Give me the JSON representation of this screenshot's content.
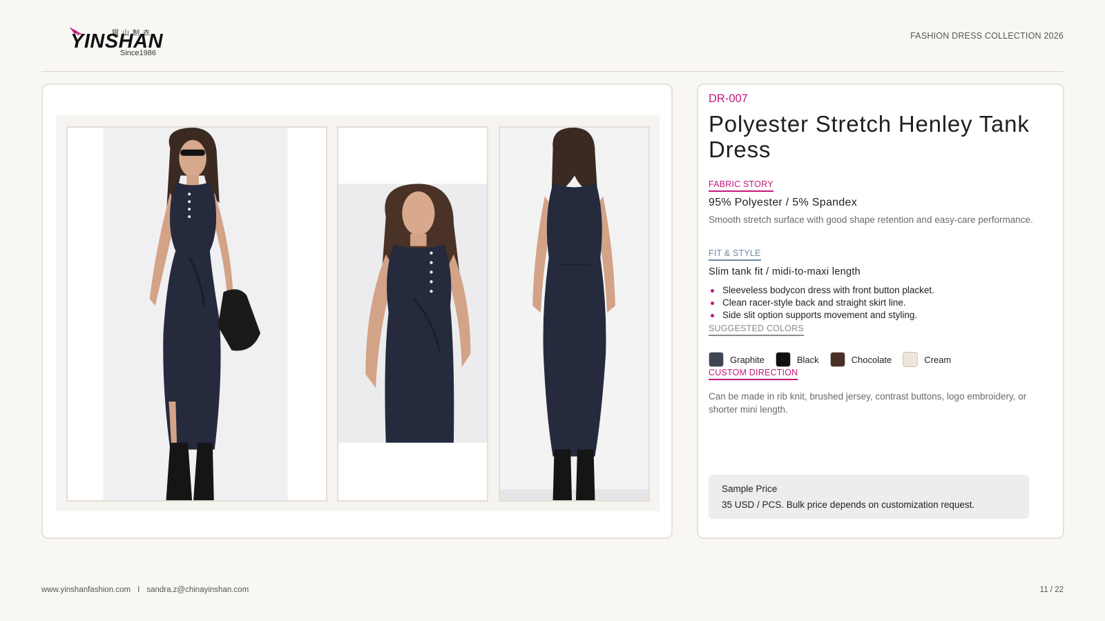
{
  "brand": {
    "name": "YINSHAN",
    "chinese_name": "银山制衣",
    "since": "Since1986",
    "accent_color": "#c2187a"
  },
  "header": {
    "collection_title": "FASHION DRESS COLLECTION 2026"
  },
  "gallery": {
    "photos": [
      {
        "view": "front-full-length",
        "dress_color": "#252a3d"
      },
      {
        "view": "front-close-up",
        "dress_color": "#252a3d"
      },
      {
        "view": "back-full-length",
        "dress_color": "#252a3d"
      }
    ]
  },
  "product": {
    "code": "DR-007",
    "title": "Polyester Stretch Henley Tank Dress",
    "fabric": {
      "label": "FABRIC STORY",
      "headline": "95% Polyester / 5% Spandex",
      "description": "Smooth stretch surface with good shape retention and easy-care performance."
    },
    "fit": {
      "label": "FIT & STYLE",
      "headline": "Slim tank fit / midi-to-maxi length",
      "bullets": [
        "Sleeveless bodycon dress with front button placket.",
        "Clean racer-style back and straight skirt line.",
        "Side slit option supports movement and styling."
      ]
    },
    "colors": {
      "label": "SUGGESTED COLORS",
      "items": [
        {
          "name": "Graphite",
          "hex": "#3e4653"
        },
        {
          "name": "Black",
          "hex": "#111111"
        },
        {
          "name": "Chocolate",
          "hex": "#4a3128"
        },
        {
          "name": "Cream",
          "hex": "#efe6da"
        }
      ]
    },
    "custom": {
      "label": "CUSTOM DIRECTION",
      "description": "Can be made in rib knit, brushed jersey, contrast buttons, logo embroidery, or shorter mini length."
    },
    "price": {
      "label": "Sample Price",
      "text": "35 USD / PCS. Bulk price depends on customization request."
    }
  },
  "footer": {
    "website": "www.yinshanfashion.com",
    "separator": "I",
    "email": "sandra.z@chinayinshan.com",
    "page": "11 / 22"
  }
}
